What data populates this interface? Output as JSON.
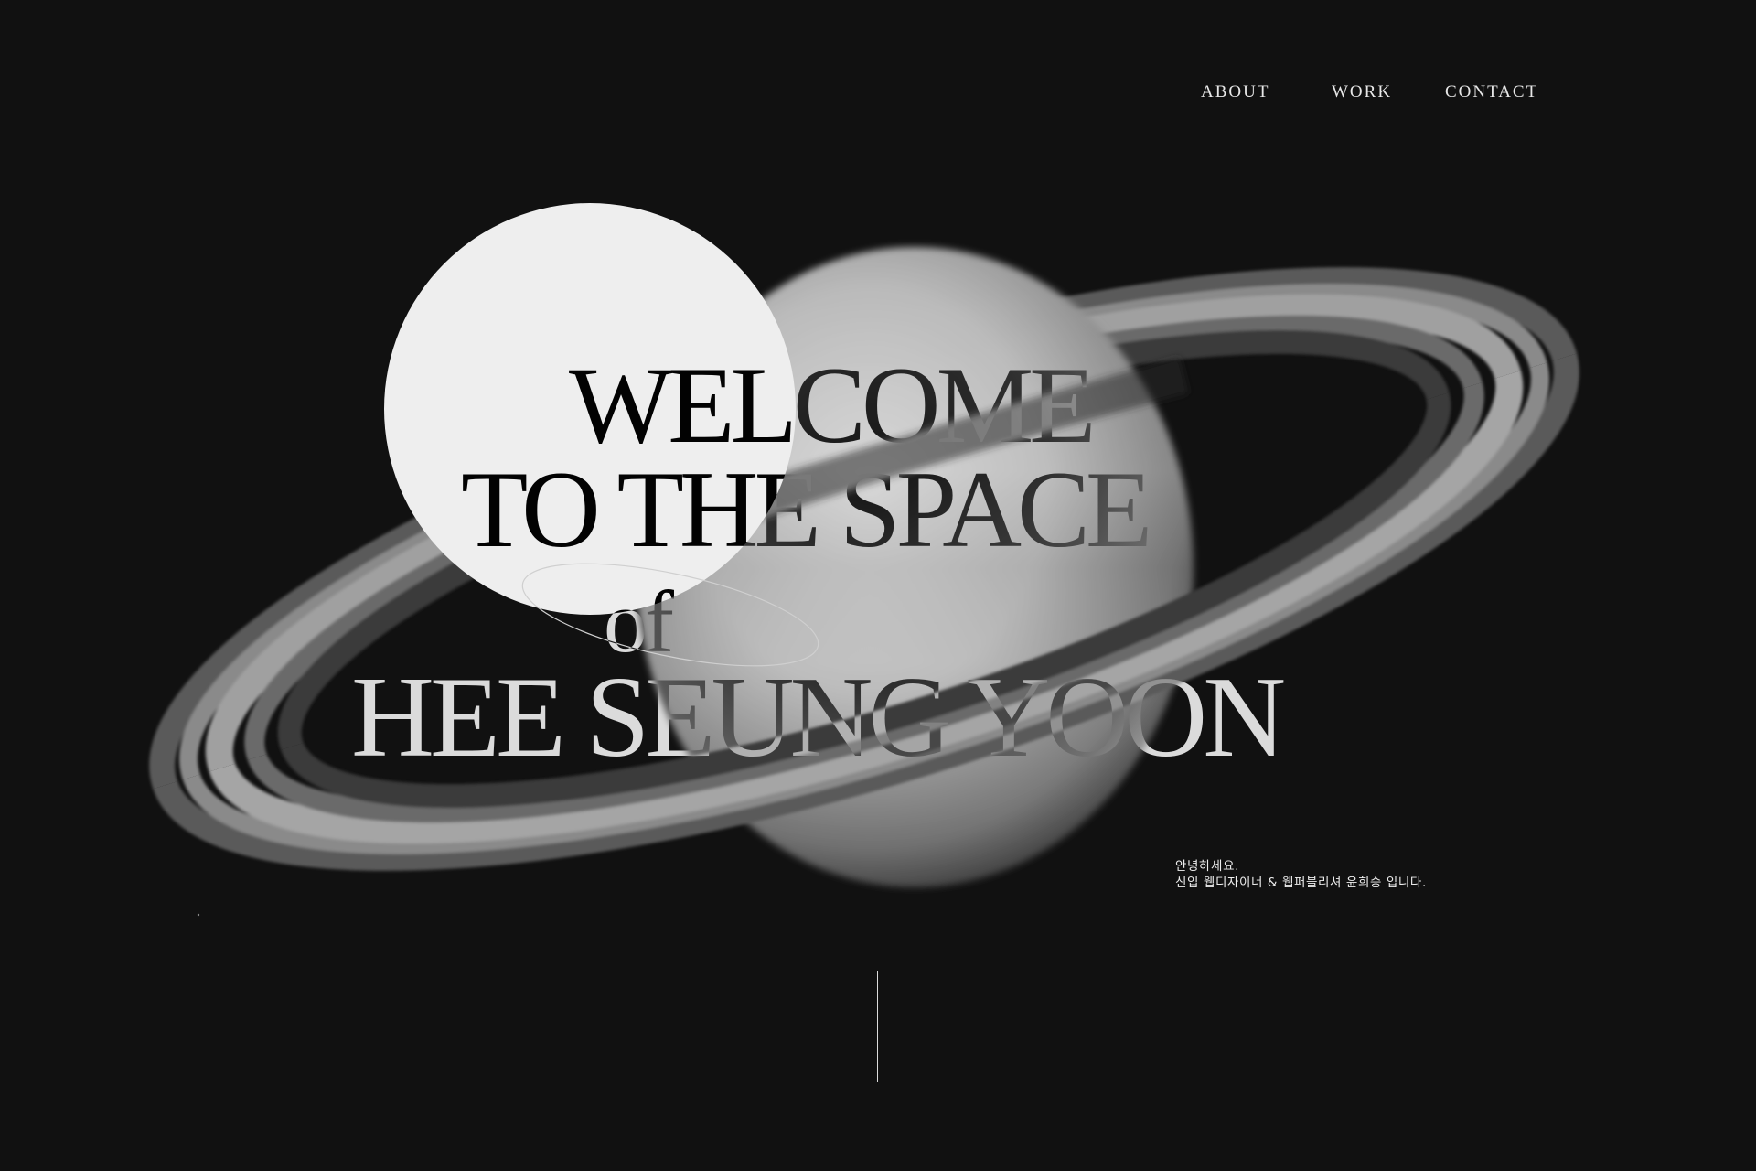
{
  "nav": {
    "about": "ABOUT",
    "work": "WORK",
    "contact": "CONTACT"
  },
  "hero": {
    "line1": "WELCOME",
    "line2": "TO THE SPACE",
    "line3": "of",
    "line4": "HEE SEUNG YOON"
  },
  "intro": {
    "greeting": "안녕하세요.",
    "description": "신입 웹디자이너 & 웹퍼블리셔 윤희승 입니다."
  },
  "colors": {
    "background": "#111111",
    "text": "#ececec",
    "disc": "#eeeeee"
  }
}
